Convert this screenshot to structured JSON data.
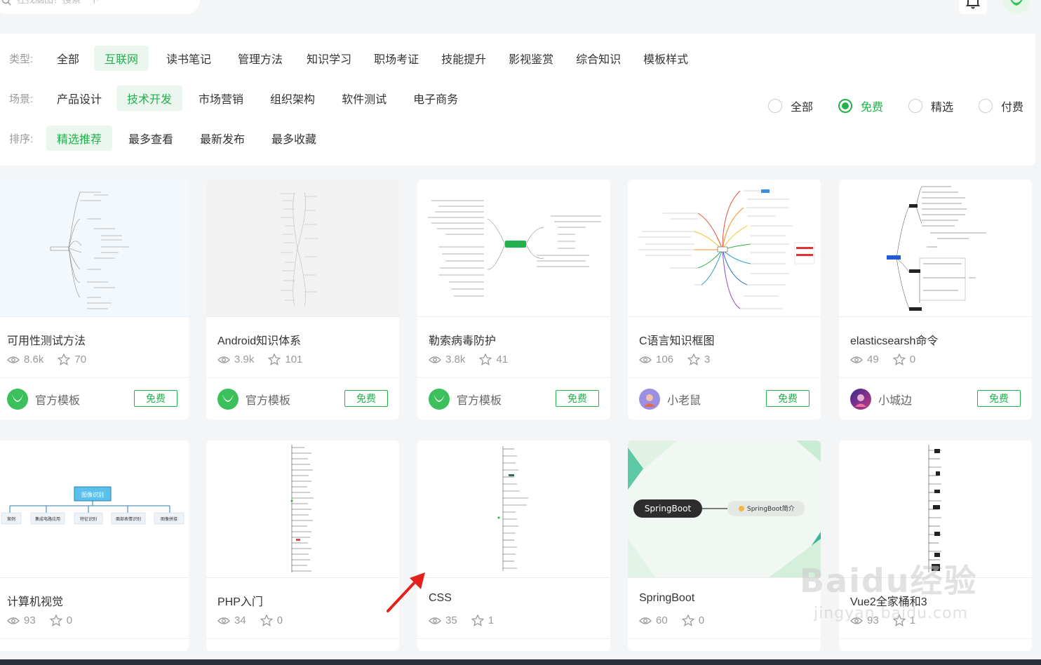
{
  "search": {
    "placeholder": "在找脑图？搜索一下"
  },
  "filters": {
    "type_label": "类型:",
    "types": [
      "全部",
      "互联网",
      "读书笔记",
      "管理方法",
      "知识学习",
      "职场考证",
      "技能提升",
      "影视鉴赏",
      "综合知识",
      "模板样式"
    ],
    "type_active": 1,
    "scene_label": "场景:",
    "scenes": [
      "产品设计",
      "技术开发",
      "市场营销",
      "组织架构",
      "软件测试",
      "电子商务"
    ],
    "scene_active": 1,
    "sort_label": "排序:",
    "sorts": [
      "精选推荐",
      "最多查看",
      "最新发布",
      "最多收藏"
    ],
    "sort_active": 0,
    "price_options": [
      "全部",
      "免费",
      "精选",
      "付费"
    ],
    "price_checked": 1
  },
  "cards": [
    {
      "title": "可用性测试方法",
      "views": "8.6k",
      "stars": "70",
      "author": "官方模板",
      "badge": "免费"
    },
    {
      "title": "Android知识体系",
      "views": "3.9k",
      "stars": "101",
      "author": "官方模板",
      "badge": "免费"
    },
    {
      "title": "勒索病毒防护",
      "views": "3.8k",
      "stars": "41",
      "author": "官方模板",
      "badge": "免费"
    },
    {
      "title": "C语言知识框图",
      "views": "106",
      "stars": "3",
      "author": "小老鼠",
      "badge": "免费"
    },
    {
      "title": "elasticsearsh命令",
      "views": "49",
      "stars": "0",
      "author": "小城边",
      "badge": "免费"
    },
    {
      "title": "计算机视觉",
      "views": "93",
      "stars": "0"
    },
    {
      "title": "PHP入门",
      "views": "34",
      "stars": "0"
    },
    {
      "title": "CSS",
      "views": "35",
      "stars": "1"
    },
    {
      "title": "SpringBoot",
      "views": "60",
      "stars": "0"
    },
    {
      "title": "Vue2全家桶和3",
      "views": "93",
      "stars": "1"
    }
  ],
  "thumbs": {
    "cv_root": "图像识别",
    "cv_children": [
      "案例",
      "集成电路应用",
      "特征识别",
      "面部表情识别",
      "图像拼接"
    ],
    "spring_root": "SpringBoot",
    "spring_child": "SpringBoot简介"
  },
  "watermark": {
    "big": "Baidu经验",
    "small": "jingyan.baidu.com"
  },
  "colors": {
    "accent": "#22b14c",
    "accent_bg": "#ebf7ee"
  }
}
